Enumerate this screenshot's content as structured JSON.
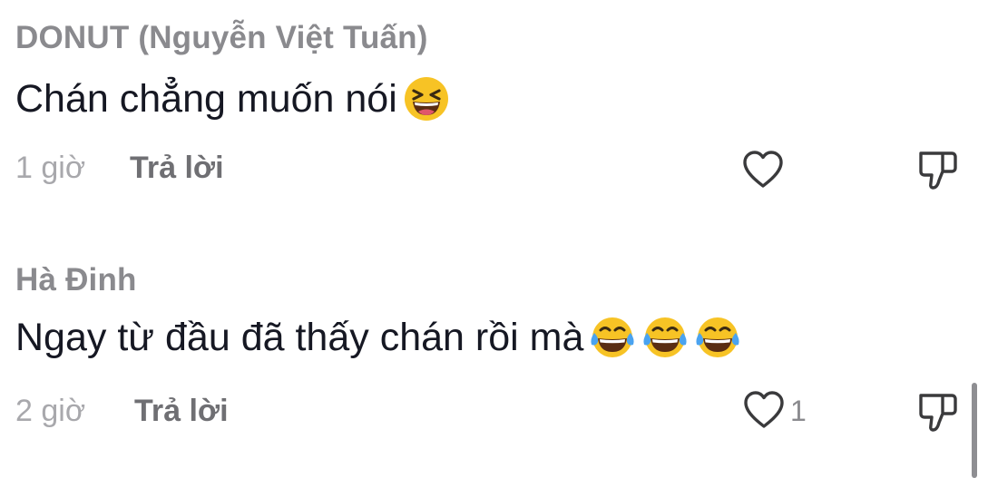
{
  "comments": [
    {
      "author": "DONUT (Nguyễn Việt Tuấn)",
      "text": "Chán chẳng muốn nói",
      "emojis": [
        "grinning-squinting-face"
      ],
      "time": "1 giờ",
      "reply_label": "Trả lời",
      "like_count": ""
    },
    {
      "author": "Hà Đinh",
      "text": "Ngay từ đầu đã thấy chán rồi mà",
      "emojis": [
        "face-with-tears-of-joy",
        "face-with-tears-of-joy",
        "face-with-tears-of-joy"
      ],
      "time": "2 giờ",
      "reply_label": "Trả lời",
      "like_count": "1"
    }
  ],
  "icons": {
    "like": "heart-outline-icon",
    "dislike": "thumbs-down-outline-icon"
  },
  "colors": {
    "author": "#8a8a8e",
    "text": "#161823",
    "time": "#a8a8ac",
    "reply": "#6f6f73",
    "emoji_face": "#f7c325",
    "emoji_tears": "#4aa3f0"
  }
}
